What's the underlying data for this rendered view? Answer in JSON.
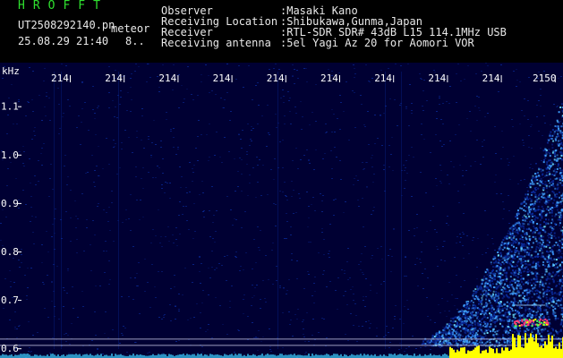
{
  "app": {
    "title": "HROFFT",
    "file_name": "UT2508292140.pn",
    "meteor_label": "meteor",
    "date_time": "25.08.29 21:40",
    "mode": "8.."
  },
  "info": [
    {
      "label": "Observer",
      "value": ":Masaki Kano"
    },
    {
      "label": "Receiving Location",
      "value": ":Shibukawa,Gunma,Japan"
    },
    {
      "label": "Receiver",
      "value": ":RTL-SDR SDR# 43dB L15 114.1MHz USB"
    },
    {
      "label": "Receiving antenna",
      "value": ":5el Yagi Az 20 for Aomori VOR"
    }
  ],
  "spectrogram": {
    "unit_label": "kHz",
    "time_ticks": [
      "214",
      "214",
      "214",
      "214",
      "214",
      "214",
      "214",
      "214",
      "214",
      "2150"
    ],
    "freq_ticks": [
      "1.1",
      "1.0",
      "0.9",
      "0.8",
      "0.7",
      "0.6"
    ],
    "freq_range": [
      0.58,
      1.19
    ],
    "colors": {
      "background": "#000033",
      "noise": "#0a2a9a",
      "signal": "#3fa0ff",
      "hot": "#ffff00",
      "echo": "#ff3b7a"
    }
  }
}
